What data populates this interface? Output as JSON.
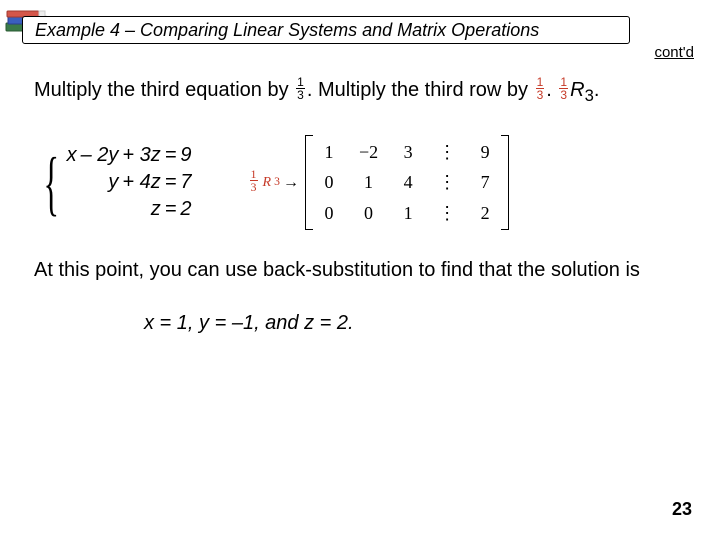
{
  "header": {
    "title": "Example 4 – Comparing Linear Systems and Matrix Operations",
    "contd": "cont'd"
  },
  "line1": {
    "a": "Multiply the third equation by ",
    "frac_n": "1",
    "frac_d": "3",
    "dot1": ".",
    "b": " Multiply the third row by ",
    "dot2": ".",
    "r3": "R",
    "r3sub": "3",
    "end": "."
  },
  "system": {
    "r1": {
      "c1": "x",
      "c2": "– 2y",
      "c3": "+ 3z",
      "eq": "=",
      "rhs": "9"
    },
    "r2": {
      "c1": "",
      "c2": "y",
      "c3": "+ 4z",
      "eq": "=",
      "rhs": "7"
    },
    "r3": {
      "c1": "",
      "c2": "",
      "c3": "z",
      "eq": "=",
      "rhs": "2"
    }
  },
  "rowop": {
    "frac_n": "1",
    "frac_d": "3",
    "R": "R",
    "sub": "3",
    "arrow": "→"
  },
  "matrix": {
    "r1": [
      "1",
      "−2",
      "3",
      "⋮",
      "9"
    ],
    "r2": [
      "0",
      "1",
      "4",
      "⋮",
      "7"
    ],
    "r3": [
      "0",
      "0",
      "1",
      "⋮",
      "2"
    ]
  },
  "conclude": "At this point, you can use back-substitution to find that the solution is",
  "solution": "x = 1, y = –1, and z = 2.",
  "pagenum": "23"
}
